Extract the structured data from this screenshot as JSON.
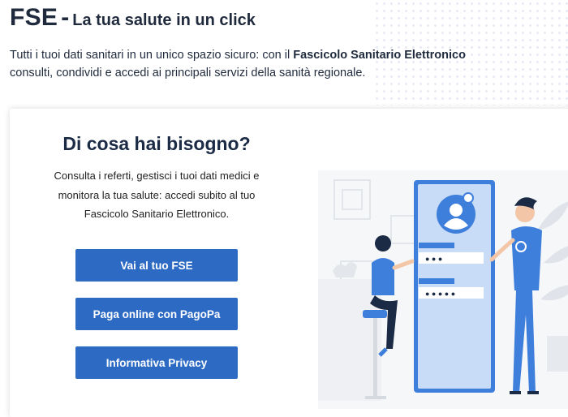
{
  "header": {
    "title_main": "FSE",
    "title_dash": "-",
    "title_sub": "La tua salute in un click",
    "lead_before": "Tutti i tuoi dati sanitari in un unico spazio sicuro: con il ",
    "lead_bold": "Fascicolo Sanitario Elettronico",
    "lead_after": " consulti, condividi e accedi ai principali servizi della sanità regionale."
  },
  "card": {
    "heading": "Di cosa hai bisogno?",
    "description": "Consulta i referti, gestisci i tuoi dati medici e monitora la tua salute: accedi subito al tuo Fascicolo Sanitario Elettronico.",
    "buttons": [
      {
        "label": "Vai al tuo FSE"
      },
      {
        "label": "Paga online con PagoPa"
      },
      {
        "label": "Informativa Privacy"
      }
    ]
  },
  "illustration": {
    "password_short": "● ● ●",
    "password_long": "● ● ● ● ●"
  },
  "colors": {
    "accent": "#2c6ac4",
    "title": "#1f2a3c",
    "illustration_blue": "#3f7fdc"
  }
}
